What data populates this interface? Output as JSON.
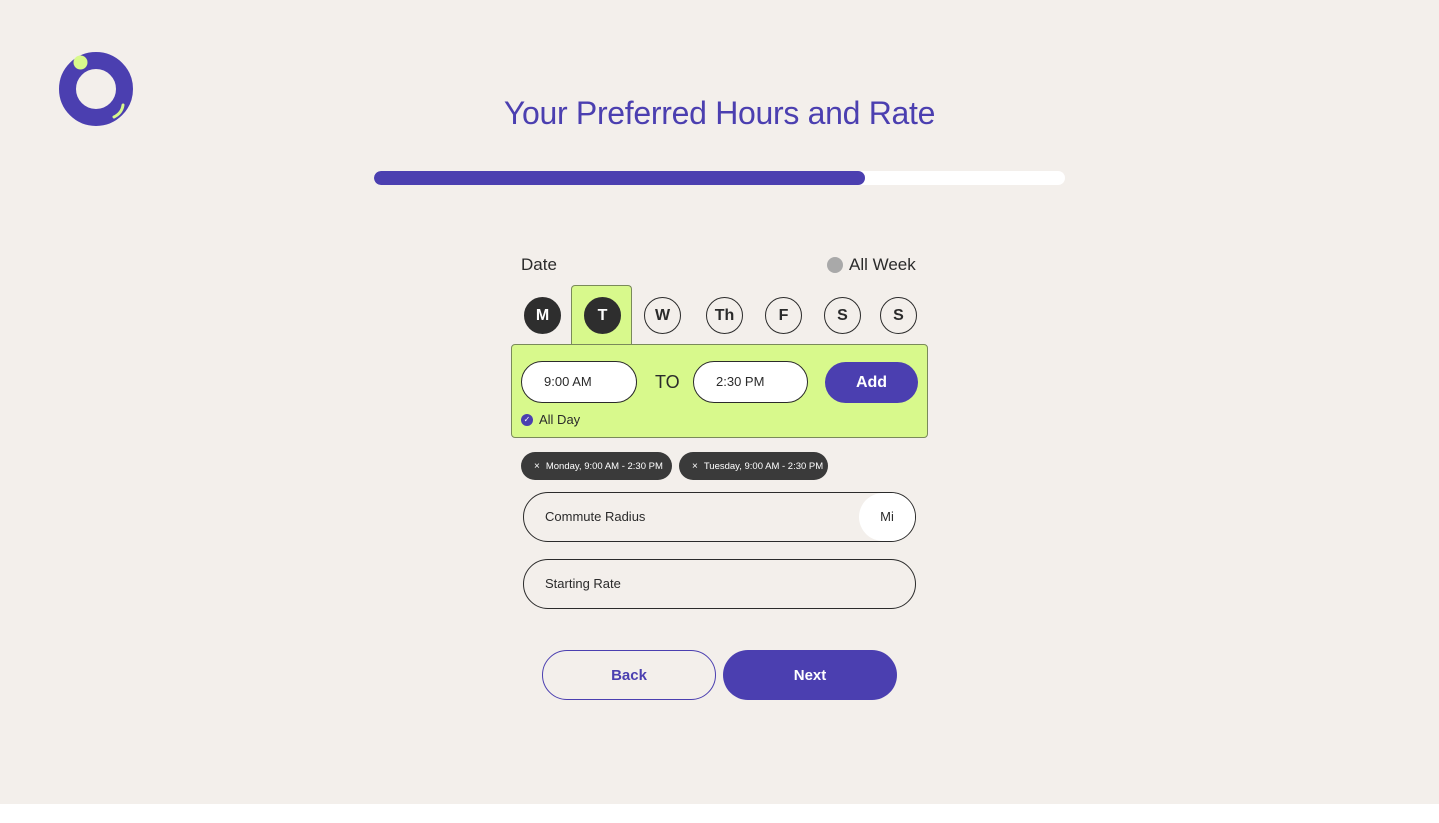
{
  "page": {
    "title": "Your Preferred Hours and Rate"
  },
  "progress": {
    "value_percent": 71
  },
  "colors": {
    "brand": "#4b3fb0",
    "accent": "#d8f98c",
    "background": "#f3efeb",
    "chip": "#3a3a3a"
  },
  "logo": {
    "icon": "app-logo-ring-icon"
  },
  "schedule": {
    "date_label": "Date",
    "all_week_label": "All Week",
    "days": [
      "M",
      "T",
      "W",
      "Th",
      "F",
      "S",
      "S"
    ],
    "selected_days": [
      "M",
      "T"
    ],
    "open_day": "T",
    "start_time": "9:00 AM",
    "to_label": "TO",
    "end_time": "2:30 PM",
    "add_label": "Add",
    "all_day_label": "All Day"
  },
  "chips": [
    {
      "label": "Monday, 9:00 AM - 2:30 PM",
      "remove_icon": "×"
    },
    {
      "label": "Tuesday, 9:00 AM - 2:30 PM",
      "remove_icon": "×"
    }
  ],
  "fields": {
    "commute_radius": {
      "placeholder": "Commute Radius",
      "unit": "Mi"
    },
    "starting_rate": {
      "placeholder": "Starting Rate"
    }
  },
  "actions": {
    "back_label": "Back",
    "next_label": "Next"
  }
}
